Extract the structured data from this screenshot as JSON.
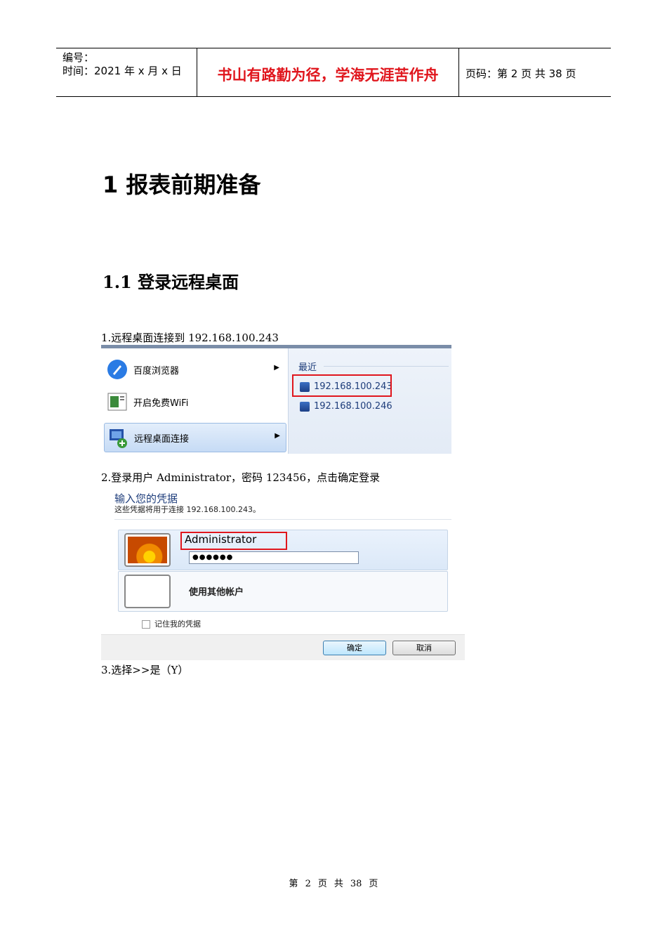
{
  "header": {
    "number_label": "编号：",
    "date_label": "时间：2021 年 x 月 x 日",
    "motto": "书山有路勤为径，学海无涯苦作舟",
    "page_info": "页码：第 2 页  共 38 页"
  },
  "heading1": "1 报表前期准备",
  "heading2": "1.1 登录远程桌面",
  "step1": "1.远程桌面连接到 192.168.100.243",
  "startmenu": {
    "items": [
      "百度浏览器",
      "开启免费WiFi",
      "远程桌面连接"
    ],
    "recent_label": "最近",
    "recent": [
      "192.168.100.243",
      "192.168.100.246"
    ]
  },
  "step2": "2.登录用户 Administrator，密码 123456，点击确定登录",
  "credentials": {
    "title": "输入您的凭据",
    "subtitle": "这些凭据将用于连接 192.168.100.243。",
    "username": "Administrator",
    "password_mask": "●●●●●●",
    "other_account": "使用其他帐户",
    "remember": "记住我的凭据",
    "ok": "确定",
    "cancel": "取消"
  },
  "step3": "3.选择>>是（Y）",
  "footer": {
    "di": "第",
    "page": "2",
    "ye": "页",
    "gong": "共",
    "total": "38",
    "ye2": "页"
  }
}
